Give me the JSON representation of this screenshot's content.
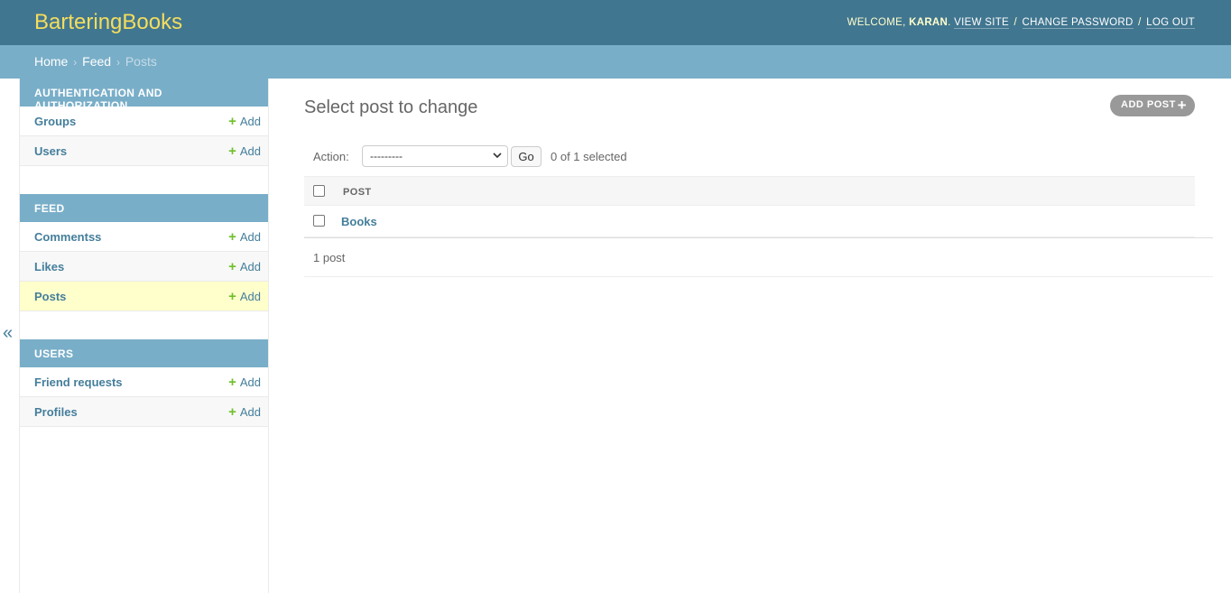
{
  "header": {
    "brand": "BarteringBooks",
    "welcome_prefix": "WELCOME,",
    "username": "KARAN",
    "welcome_suffix": ".",
    "view_site": "VIEW SITE",
    "change_password": "CHANGE PASSWORD",
    "log_out": "LOG OUT",
    "separator": "/"
  },
  "breadcrumbs": {
    "home": "Home",
    "feed": "Feed",
    "current": "Posts",
    "separator": "›"
  },
  "sidebar": {
    "toggle": "«",
    "modules": [
      {
        "caption": "AUTHENTICATION AND AUTHORIZATION",
        "items": [
          {
            "label": "Groups",
            "add": "Add"
          },
          {
            "label": "Users",
            "add": "Add"
          }
        ]
      },
      {
        "caption": "FEED",
        "items": [
          {
            "label": "Commentss",
            "add": "Add"
          },
          {
            "label": "Likes",
            "add": "Add"
          },
          {
            "label": "Posts",
            "add": "Add",
            "current": true
          }
        ]
      },
      {
        "caption": "USERS",
        "items": [
          {
            "label": "Friend requests",
            "add": "Add"
          },
          {
            "label": "Profiles",
            "add": "Add"
          }
        ]
      }
    ]
  },
  "content": {
    "title": "Select post to change",
    "add_button": "ADD POST",
    "actions": {
      "label": "Action:",
      "selected_option": "---------",
      "go": "Go",
      "counter": "0 of 1 selected"
    },
    "table": {
      "column_header": "POST",
      "rows": [
        {
          "title": "Books"
        }
      ]
    },
    "paginator": "1 post"
  },
  "colors": {
    "header_bg": "#417690",
    "breadcrumb_bg": "#79aec8",
    "brand": "#f5dd5d",
    "link": "#447e9b",
    "add_icon": "#70bf2b",
    "current_row": "#ffffcc"
  }
}
